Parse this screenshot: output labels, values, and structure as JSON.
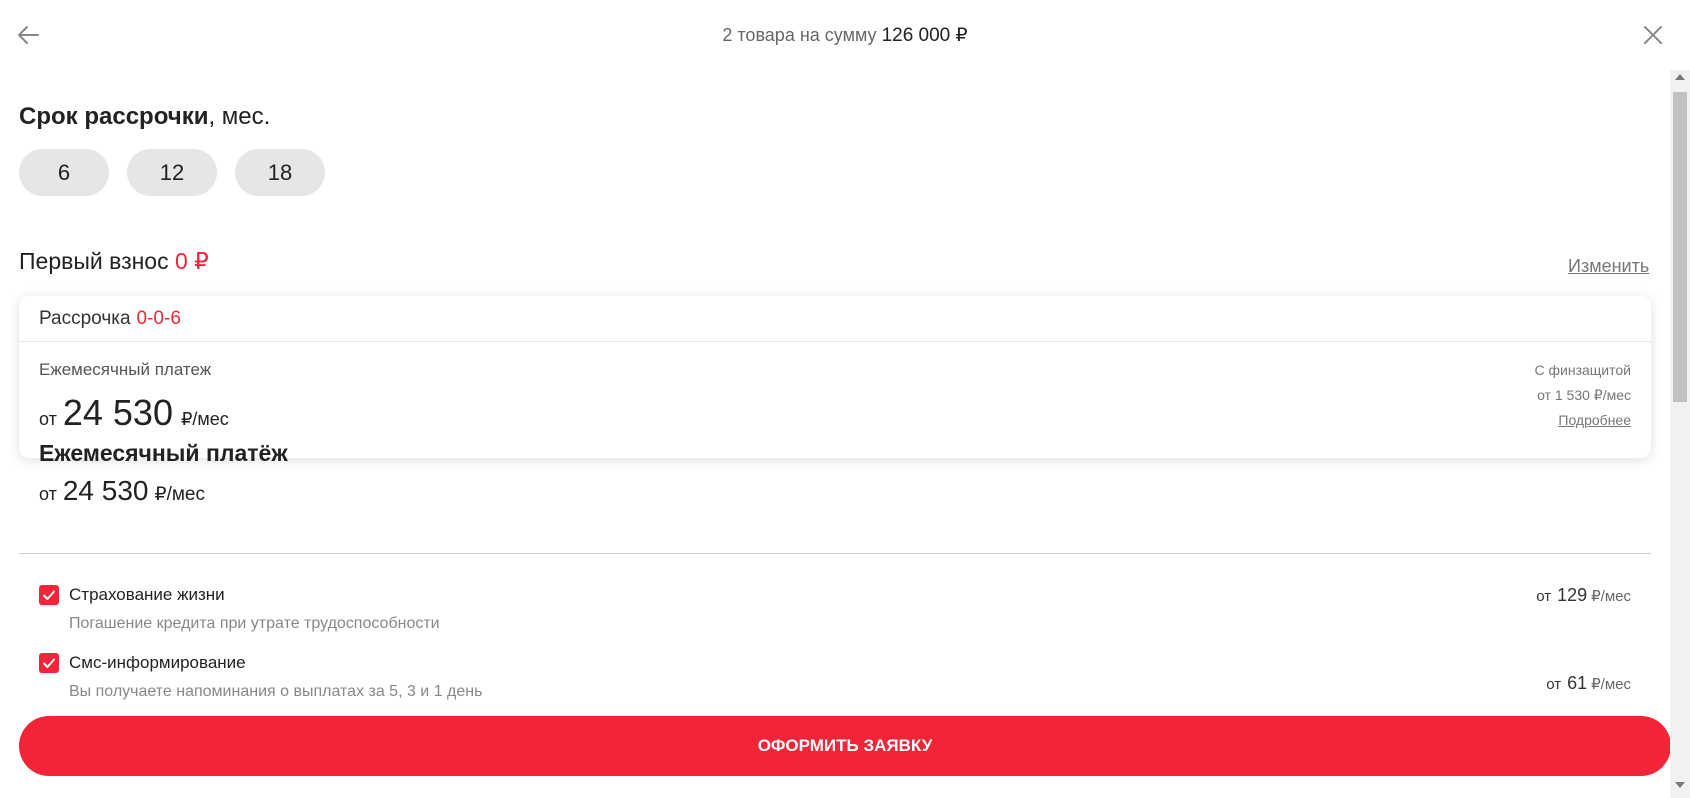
{
  "header": {
    "title_prefix": "2 товара на сумму",
    "total": "126 000 ₽",
    "back_icon": "arrow-left-icon",
    "close_icon": "close-icon"
  },
  "term": {
    "title": "Срок рассрочки",
    "unit": ", мес.",
    "options": [
      "6",
      "12",
      "18"
    ]
  },
  "first_payment": {
    "label": "Первый взнос",
    "value": "0 ₽",
    "change_label": "Изменить"
  },
  "plan_card": {
    "name": "Рассрочка",
    "code": "0-0-6",
    "monthly_label": "Ежемесячный платеж",
    "amount_prefix": "от",
    "amount": "24 530",
    "amount_unit": "₽/мес",
    "protection_title": "С финзащитой",
    "protection_price": "от 1 530 ₽/мес",
    "more_label": "Подробнее"
  },
  "summary": {
    "title": "Ежемесячный платёж",
    "prefix": "от",
    "amount": "24 530",
    "unit": "₽/мес"
  },
  "options": [
    {
      "label": "Страхование жизни",
      "description": "Погашение кредита при утрате трудоспособности",
      "price_prefix": "от",
      "price": "129",
      "price_unit": "₽/мес",
      "checked": true
    },
    {
      "label": "Смс-информирование",
      "description": "Вы получаете напоминания о выплатах за 5, 3 и 1 день",
      "price_prefix": "от",
      "price": "61",
      "price_unit": "₽/мес",
      "checked": true
    }
  ],
  "submit": {
    "label": "ОФОРМИТЬ ЗАЯВКУ"
  },
  "colors": {
    "accent": "#f22437",
    "chip_bg": "#e6e6e6"
  }
}
